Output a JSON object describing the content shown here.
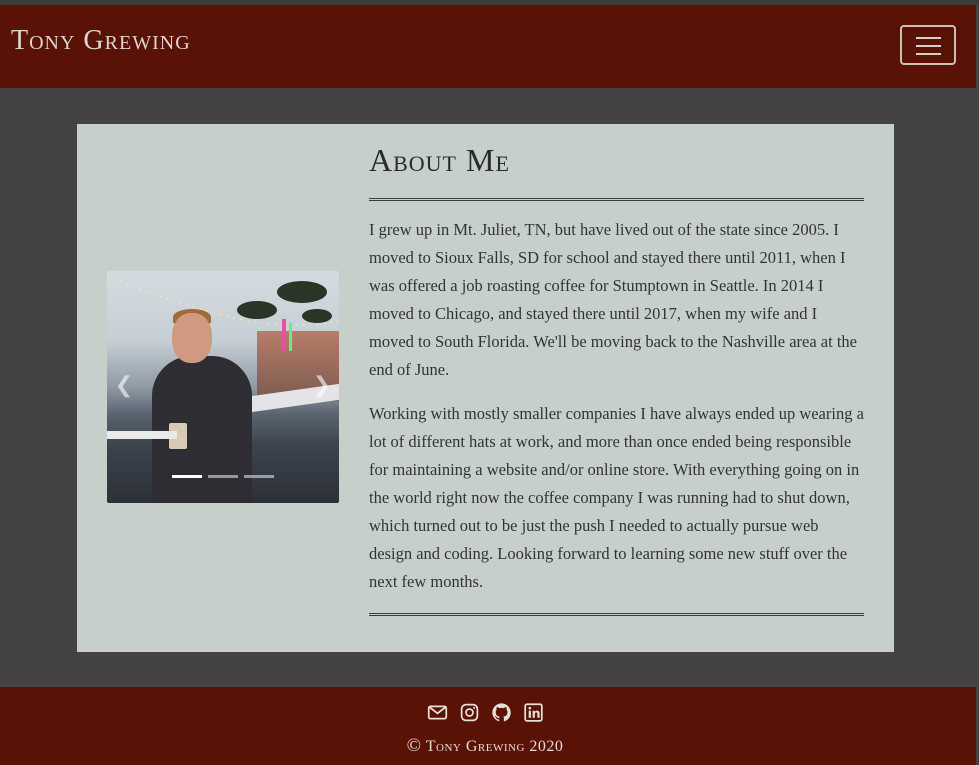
{
  "navbar": {
    "brand": "Tony Grewing",
    "toggle_icon": "hamburger-menu-icon"
  },
  "about": {
    "title": "About Me",
    "paragraphs": [
      "I grew up in Mt. Juliet, TN, but have lived out of the state since 2005. I moved to Sioux Falls, SD for school and stayed there until 2011, when I was offered a job roasting coffee for Stumptown in Seattle. In 2014 I moved to Chicago, and stayed there until 2017, when my wife and I moved to South Florida. We'll be moving back to the Nashville area at the end of June.",
      "Working with mostly smaller companies I have always ended up wearing a lot of different hats at work, and more than once ended being responsible for maintaining a website and/or online store. With everything going on in the world right now the coffee company I was running had to shut down, which turned out to be just the push I needed to actually pursue web design and coding. Looking forward to learning some new stuff over the next few months."
    ]
  },
  "carousel": {
    "prev_icon": "chevron-left-icon",
    "next_icon": "chevron-right-icon",
    "slide_count": 3,
    "active_slide": 1
  },
  "footer": {
    "icons": [
      "envelope-icon",
      "instagram-icon",
      "github-icon",
      "linkedin-icon"
    ],
    "copyright_symbol": "©",
    "copyright_text": "Tony Grewing 2020"
  },
  "colors": {
    "navbar_bg": "#5a1207",
    "page_bg": "#444242",
    "card_bg": "#c6cfca",
    "brand_text": "#ddd6cf"
  }
}
